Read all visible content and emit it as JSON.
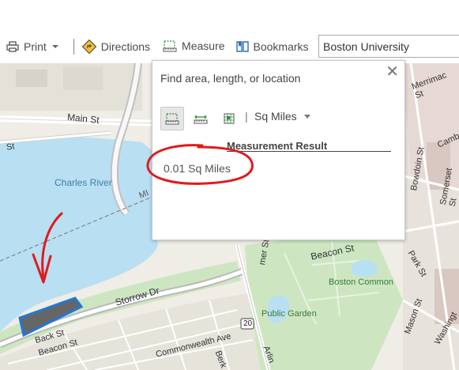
{
  "toolbar": {
    "print_label": "Print",
    "directions_label": "Directions",
    "measure_label": "Measure",
    "bookmarks_label": "Bookmarks",
    "accent_color": "#1f78c8"
  },
  "search": {
    "value": "Boston University"
  },
  "measure_panel": {
    "title": "Find area, length, or location",
    "close_glyph": "✕",
    "unit": "Sq Miles",
    "unit_separator": "|",
    "result_title": "Measurement Result",
    "result_value": "0.01 Sq Miles"
  },
  "map": {
    "labels": {
      "main_st": "Main St",
      "charles_river": "Charles River",
      "merrimac_st": "Merrimac St",
      "cambridge": "Camb",
      "somerset_st": "Somerset St",
      "bowdoin_st": "Bowdoin St",
      "park_st": "Park St",
      "beacon_st_upper": "Beacon St",
      "boston_common": "Boston Common",
      "public_garden": "Public Garden",
      "storrow_dr": "Storrow Dr",
      "back_st": "Back St",
      "beacon_st_lower": "Beacon St",
      "commonwealth_ave": "Commonwealth Ave",
      "mason_st": "Mason St",
      "washington": "Washingt",
      "route_20": "20",
      "berkeley": "Berk",
      "arlington": "Arlin",
      "st_left": "St",
      "mer_st": "mer St",
      "mi": "MI"
    },
    "water_color": "#b9dff3",
    "park_color": "#cde6c1",
    "highlight_color": "#1f78d8"
  },
  "annotation": {
    "color": "#e01b1b"
  }
}
